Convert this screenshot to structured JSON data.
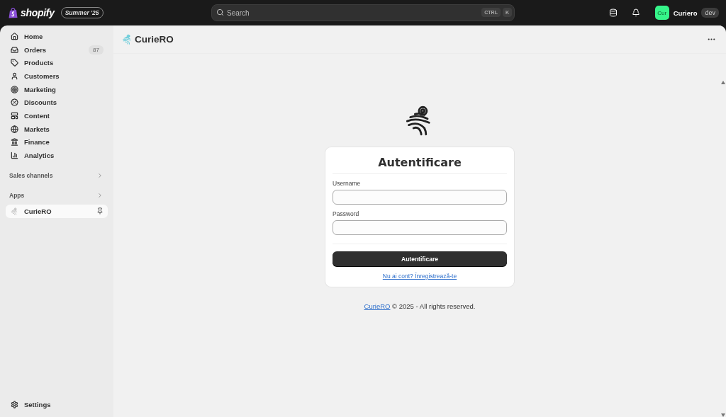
{
  "topbar": {
    "brand": "shopify",
    "edition": "Summer '25",
    "search": {
      "placeholder": "Search"
    },
    "shortcut": [
      "CTRL",
      "K"
    ],
    "store": {
      "avatar": "Cur",
      "name": "Curiero",
      "badge": "dev"
    }
  },
  "sidebar": {
    "items": [
      {
        "label": "Home",
        "selected": false
      },
      {
        "label": "Orders",
        "count": "87",
        "selected": false
      },
      {
        "label": "Products",
        "selected": false
      },
      {
        "label": "Customers",
        "selected": false
      },
      {
        "label": "Marketing",
        "selected": false
      },
      {
        "label": "Discounts",
        "selected": false
      },
      {
        "label": "Content",
        "selected": false
      },
      {
        "label": "Markets",
        "selected": false
      },
      {
        "label": "Finance",
        "selected": false
      },
      {
        "label": "Analytics",
        "selected": false
      }
    ],
    "sections": [
      {
        "label": "Sales channels"
      },
      {
        "label": "Apps"
      }
    ],
    "apps": [
      {
        "label": "CurieRO",
        "selected": true
      }
    ],
    "settings": "Settings"
  },
  "page": {
    "title": "CurieRO"
  },
  "login": {
    "title": "Autentificare",
    "fields": [
      {
        "label": "Username"
      },
      {
        "label": "Password"
      }
    ],
    "button": "Autentificare",
    "link": "Nu ai cont? Înregistrează-te"
  },
  "footer": {
    "link": "CurieRO",
    "text": " © 2025 - All rights reserved."
  }
}
